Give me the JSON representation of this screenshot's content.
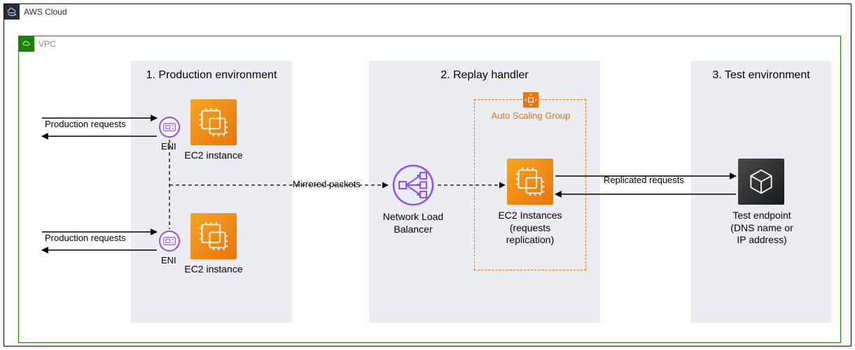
{
  "aws_label": "AWS Cloud",
  "vpc_label": "VPC",
  "zones": {
    "prod": "1. Production environment",
    "replay": "2. Replay handler",
    "test": "3. Test environment"
  },
  "labels": {
    "eni": "ENI",
    "ec2": "EC2 instance",
    "prod_req": "Production requests",
    "mirrored": "Mirrored packets",
    "nlb": "Network Load\nBalancer",
    "asg": "Auto Scaling Group",
    "ec2_rep": "EC2 Instances\n(requests\nreplication)",
    "replicated": "Replicated requests",
    "endpoint": "Test endpoint\n(DNS name or\nIP address)"
  },
  "chart_data": {
    "type": "diagram",
    "title": "AWS traffic mirroring / replay architecture",
    "containers": [
      {
        "id": "aws",
        "label": "AWS Cloud",
        "children": [
          "vpc"
        ]
      },
      {
        "id": "vpc",
        "label": "VPC",
        "children": [
          "prod",
          "replay",
          "test"
        ]
      },
      {
        "id": "prod",
        "label": "1. Production environment"
      },
      {
        "id": "replay",
        "label": "2. Replay handler"
      },
      {
        "id": "test",
        "label": "3. Test environment"
      }
    ],
    "nodes": [
      {
        "id": "eni1",
        "label": "ENI",
        "container": "prod",
        "icon": "eni"
      },
      {
        "id": "ec2a",
        "label": "EC2 instance",
        "container": "prod",
        "icon": "ec2"
      },
      {
        "id": "eni2",
        "label": "ENI",
        "container": "prod",
        "icon": "eni"
      },
      {
        "id": "ec2b",
        "label": "EC2 instance",
        "container": "prod",
        "icon": "ec2"
      },
      {
        "id": "nlb",
        "label": "Network Load Balancer",
        "container": "replay",
        "icon": "nlb"
      },
      {
        "id": "asg",
        "label": "Auto Scaling Group",
        "container": "replay",
        "type": "group"
      },
      {
        "id": "ec2rep",
        "label": "EC2 Instances (requests replication)",
        "container": "asg",
        "icon": "ec2"
      },
      {
        "id": "endpoint",
        "label": "Test endpoint (DNS name or IP address)",
        "container": "test",
        "icon": "endpoint"
      }
    ],
    "edges": [
      {
        "from": "external",
        "to": "eni1",
        "label": "Production requests",
        "style": "solid",
        "bidirectional": true
      },
      {
        "from": "external",
        "to": "eni2",
        "label": "Production requests",
        "style": "solid",
        "bidirectional": true
      },
      {
        "from": "eni1",
        "to": "nlb",
        "label": "Mirrored packets",
        "style": "dashed",
        "via": "eni2-level"
      },
      {
        "from": "eni2",
        "to": "nlb",
        "label": "Mirrored packets",
        "style": "dashed"
      },
      {
        "from": "nlb",
        "to": "ec2rep",
        "style": "dashed"
      },
      {
        "from": "ec2rep",
        "to": "endpoint",
        "label": "Replicated requests",
        "style": "solid",
        "bidirectional": true
      }
    ]
  }
}
